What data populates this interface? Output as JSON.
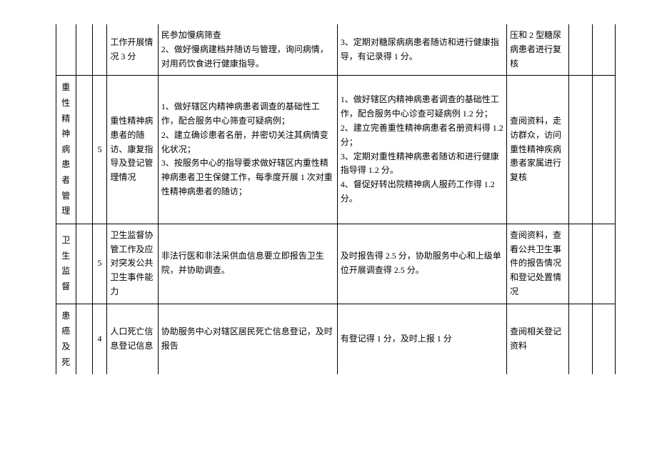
{
  "rows": [
    {
      "category": "",
      "score": "",
      "item": "工作开展情况 3 分",
      "description": "民参加慢病筛查\n2、做好慢病建档并随访与管理，询问病情，对用药饮食进行健康指导。",
      "criteria": "3、定期对糖尿病病患者随访和进行健康指导，有记录得 1 分。",
      "method": "压和 2 型糖尿病患者进行复核"
    },
    {
      "category": "重 性 精 神 病 患 者 管 理",
      "score": "5",
      "item": "重性精神病患者的随访、康复指导及登记管理情况",
      "description": "1、做好辖区内精神病患者调查的基础性工作，配合服务中心筛查可疑病例；\n2、建立确诊患者名册，并密切关注其病情变化状况；\n3、按服务中心的指导要求做好辖区内重性精神病患者卫生保健工作，每季度开展 1 次对重性精神病患者的随访；",
      "criteria": "1、做好辖区内精神病患者调查的基础性工作，配合服务中心诊查可疑病例 1.2 分；\n2、建立完善重性精神病患者名册资料得 1.2 分；\n3、定期对重性精神病患者随访和进行健康指导得 1.2 分。\n4、督促好转出院精神病人服药工作得 1.2 分。",
      "method": "查阅资料，走访群众，访问重性精神疾病患者家属进行复核"
    },
    {
      "category": "卫 生 监 督",
      "score": "5",
      "item": "卫生监督协管工作及应对突发公共卫生事件能力",
      "description": "非法行医和非法采供血信息要立即报告卫生院，并协助调查。",
      "criteria": "及时报告得 2.5 分，协助服务中心和上级单位开展调查得 2.5 分。",
      "method": "查阅资料，查看公共卫生事件的报告情况和登记处置情况"
    },
    {
      "category": "患 癌 及 死",
      "score": "4",
      "item": "人口死亡信息登记信息",
      "description": "协助服务中心对辖区居民死亡信息登记，及时报告",
      "criteria": "有登记得 1 分，及时上报 1 分",
      "method": "查阅相关登记资料"
    }
  ]
}
